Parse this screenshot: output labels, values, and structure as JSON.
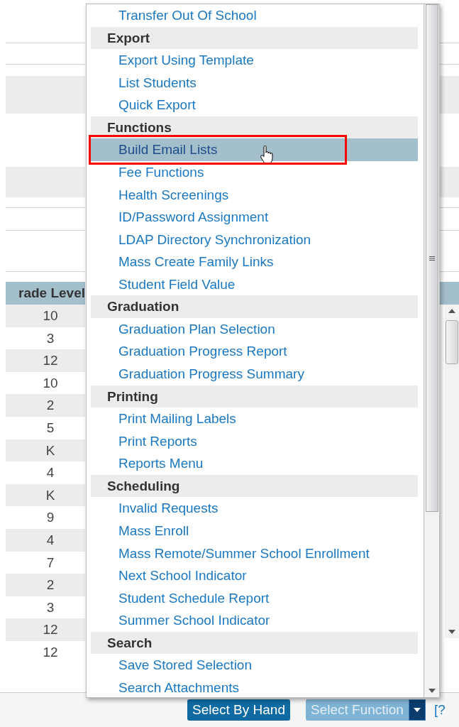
{
  "grade_table": {
    "column": "rade Level",
    "rows": [
      "10",
      "3",
      "12",
      "10",
      "2",
      "5",
      "K",
      "4",
      "K",
      "9",
      "4",
      "7",
      "2",
      "3",
      "12",
      "12"
    ]
  },
  "menu": {
    "items": [
      {
        "kind": "option",
        "label": "Transfer Out Of School",
        "selected": false,
        "outlined": false
      },
      {
        "kind": "header",
        "label": "Export"
      },
      {
        "kind": "option",
        "label": "Export Using Template",
        "selected": false,
        "outlined": false
      },
      {
        "kind": "option",
        "label": "List Students",
        "selected": false,
        "outlined": false
      },
      {
        "kind": "option",
        "label": "Quick Export",
        "selected": false,
        "outlined": false
      },
      {
        "kind": "header",
        "label": "Functions"
      },
      {
        "kind": "option",
        "label": "Build Email Lists",
        "selected": true,
        "outlined": true
      },
      {
        "kind": "option",
        "label": "Fee Functions",
        "selected": false,
        "outlined": false
      },
      {
        "kind": "option",
        "label": "Health Screenings",
        "selected": false,
        "outlined": false
      },
      {
        "kind": "option",
        "label": "ID/Password Assignment",
        "selected": false,
        "outlined": false
      },
      {
        "kind": "option",
        "label": "LDAP Directory Synchronization",
        "selected": false,
        "outlined": false
      },
      {
        "kind": "option",
        "label": "Mass Create Family Links",
        "selected": false,
        "outlined": false
      },
      {
        "kind": "option",
        "label": "Student Field Value",
        "selected": false,
        "outlined": false
      },
      {
        "kind": "header",
        "label": "Graduation"
      },
      {
        "kind": "option",
        "label": "Graduation Plan Selection",
        "selected": false,
        "outlined": false
      },
      {
        "kind": "option",
        "label": "Graduation Progress Report",
        "selected": false,
        "outlined": false
      },
      {
        "kind": "option",
        "label": "Graduation Progress Summary",
        "selected": false,
        "outlined": false
      },
      {
        "kind": "header",
        "label": "Printing"
      },
      {
        "kind": "option",
        "label": "Print Mailing Labels",
        "selected": false,
        "outlined": false
      },
      {
        "kind": "option",
        "label": "Print Reports",
        "selected": false,
        "outlined": false
      },
      {
        "kind": "option",
        "label": "Reports Menu",
        "selected": false,
        "outlined": false
      },
      {
        "kind": "header",
        "label": "Scheduling"
      },
      {
        "kind": "option",
        "label": "Invalid Requests",
        "selected": false,
        "outlined": false
      },
      {
        "kind": "option",
        "label": "Mass Enroll",
        "selected": false,
        "outlined": false
      },
      {
        "kind": "option",
        "label": "Mass Remote/Summer School Enrollment",
        "selected": false,
        "outlined": false
      },
      {
        "kind": "option",
        "label": "Next School Indicator",
        "selected": false,
        "outlined": false
      },
      {
        "kind": "option",
        "label": "Student Schedule Report",
        "selected": false,
        "outlined": false
      },
      {
        "kind": "option",
        "label": "Summer School Indicator",
        "selected": false,
        "outlined": false
      },
      {
        "kind": "header",
        "label": "Search"
      },
      {
        "kind": "option",
        "label": "Save Stored Selection",
        "selected": false,
        "outlined": false
      },
      {
        "kind": "option",
        "label": "Search Attachments",
        "selected": false,
        "outlined": false
      }
    ]
  },
  "buttons": {
    "select_by_hand": "Select By Hand",
    "select_function": "Select Function",
    "help": "[?"
  }
}
